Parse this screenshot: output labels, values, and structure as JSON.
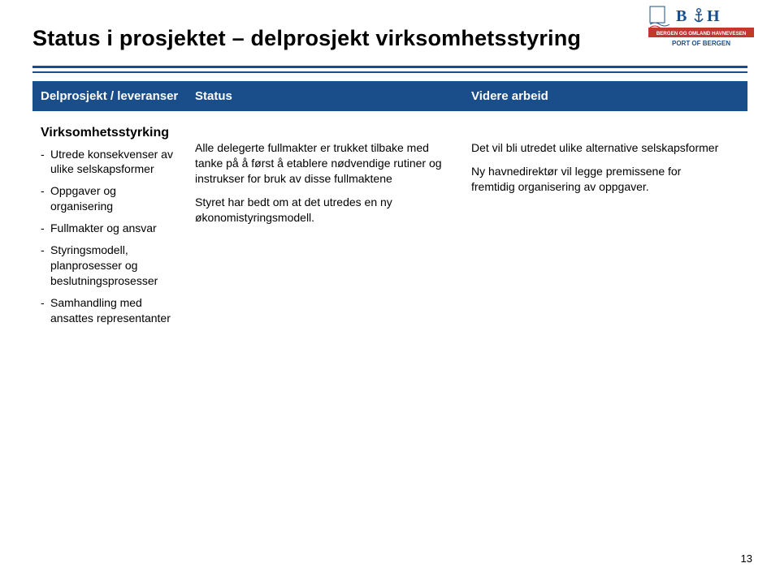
{
  "header": {
    "logo_top": "BOH",
    "logo_mid": "BERGEN OG OMLAND HAVNEVESEN",
    "logo_bot": "PORT OF BERGEN"
  },
  "title": "Status i prosjektet – delprosjekt virksomhetsstyring",
  "table": {
    "headers": {
      "col1": "Delprosjekt / leveranser",
      "col2": "Status",
      "col3": "Videre arbeid"
    },
    "col1": {
      "subhead": "Virksomhetsstyrking",
      "items": [
        "Utrede konsekvenser av ulike selskapsformer",
        "Oppgaver og organisering",
        "Fullmakter og ansvar",
        "Styringsmodell, planprosesser og beslutningsprosesser",
        "Samhandling med ansattes representanter"
      ]
    },
    "col2": {
      "p1": "Alle delegerte fullmakter er trukket tilbake  med tanke på å først å etablere nødvendige rutiner og instrukser for bruk av disse fullmaktene",
      "p2": "Styret har bedt om at det utredes en ny økonomistyringsmodell."
    },
    "col3": {
      "p1": "Det vil bli utredet ulike alternative selskapsformer",
      "p2": "Ny havnedirektør vil legge premissene for fremtidig organisering av oppgaver."
    }
  },
  "page_number": "13"
}
